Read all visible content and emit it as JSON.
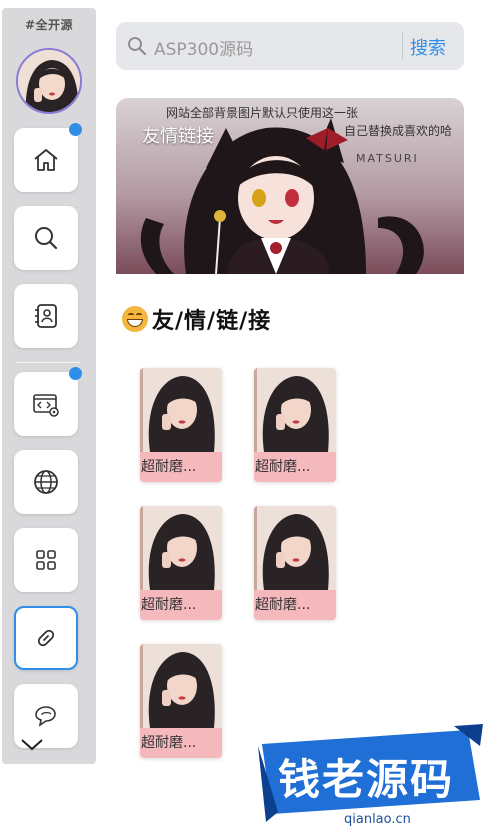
{
  "sidebar": {
    "site_tag": "#全开源",
    "nav": [
      {
        "name": "home",
        "badge": true
      },
      {
        "name": "search",
        "badge": false
      },
      {
        "name": "contacts",
        "badge": false
      },
      {
        "name": "code",
        "badge": true
      },
      {
        "name": "globe",
        "badge": false
      },
      {
        "name": "apps",
        "badge": false
      },
      {
        "name": "link",
        "badge": false,
        "active": true
      },
      {
        "name": "chat",
        "badge": false
      }
    ]
  },
  "search": {
    "placeholder": "ASP300源码",
    "button": "搜索"
  },
  "banner": {
    "title": "友情链接",
    "line1": "网站全部背景图片默认只使用这一张",
    "line2": "自己替换成喜欢的哈",
    "signature": "MATSURI"
  },
  "section": {
    "title": "友/情/链/接"
  },
  "links": [
    {
      "label": "超耐磨..."
    },
    {
      "label": "超耐磨..."
    },
    {
      "label": "超耐磨..."
    },
    {
      "label": "超耐磨..."
    },
    {
      "label": "超耐磨..."
    }
  ],
  "watermark": {
    "title": "钱老源码",
    "domain": "qianlao.cn"
  },
  "colors": {
    "accent": "#2f8fe8",
    "card_label_bg": "#f4b8bd",
    "sidebar_bg": "#d9d9dc"
  }
}
